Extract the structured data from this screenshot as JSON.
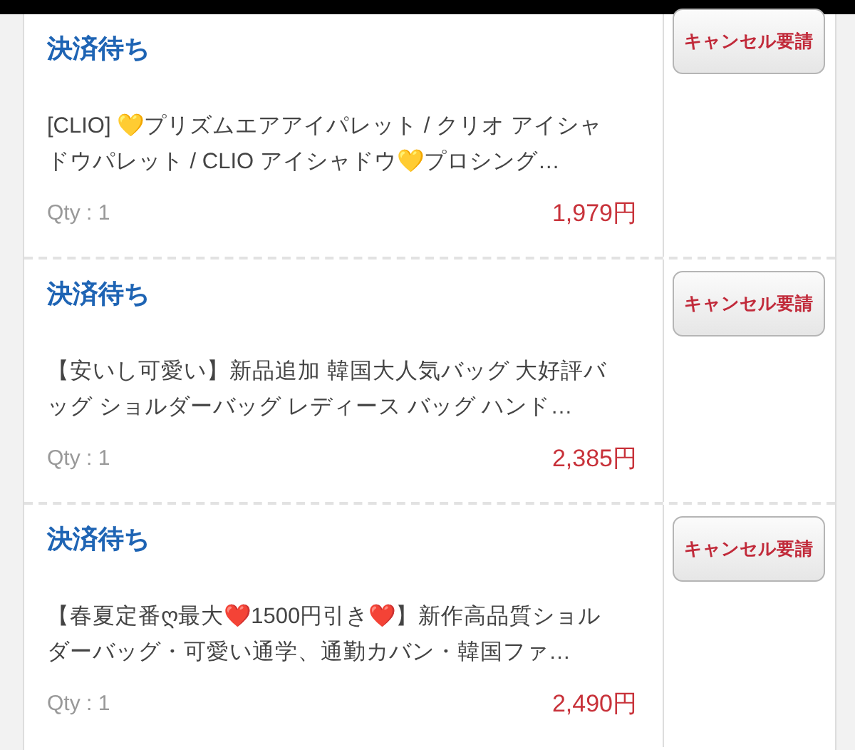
{
  "orders": [
    {
      "status": "決済待ち",
      "title": "[CLIO] 💛プリズムエアアイパレット / クリオ アイシャドウパレット / CLIO アイシャドウ💛プロシング…",
      "qty": "Qty : 1",
      "price": "1,979円",
      "action": "キャンセル要請"
    },
    {
      "status": "決済待ち",
      "title": "【安いし可愛い】新品追加 韓国大人気バッグ 大好評バッグ ショルダーバッグ レディース バッグ ハンド…",
      "qty": "Qty : 1",
      "price": "2,385円",
      "action": "キャンセル要請"
    },
    {
      "status": "決済待ち",
      "title": "【春夏定番ღ最大❤️1500円引き❤️】新作高品質ショルダーバッグ・可愛い通学、通勤カバン・韓国ファ…",
      "qty": "Qty : 1",
      "price": "2,490円",
      "action": "キャンセル要請"
    }
  ]
}
